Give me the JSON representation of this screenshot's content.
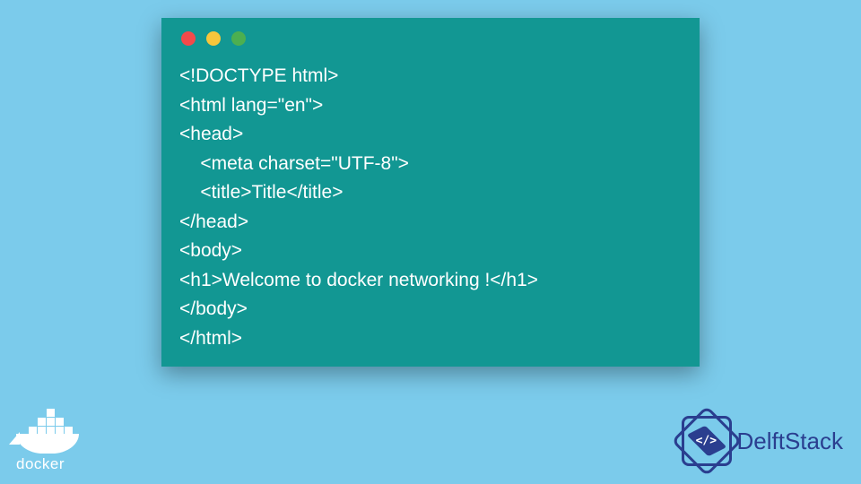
{
  "code": {
    "lines": [
      "<!DOCTYPE html>",
      "<html lang=\"en\">",
      "<head>",
      "    <meta charset=\"UTF-8\">",
      "    <title>Title</title>",
      "</head>",
      "<body>",
      "<h1>Welcome to docker networking !</h1>",
      "</body>",
      "</html>"
    ]
  },
  "logos": {
    "docker_label": "docker",
    "delftstack_label": "DelftStack",
    "delftstack_symbol": "</>"
  },
  "colors": {
    "background": "#7bcbeb",
    "window": "#129793",
    "code_text": "#ffffff",
    "brand_blue": "#2a3e8f"
  }
}
